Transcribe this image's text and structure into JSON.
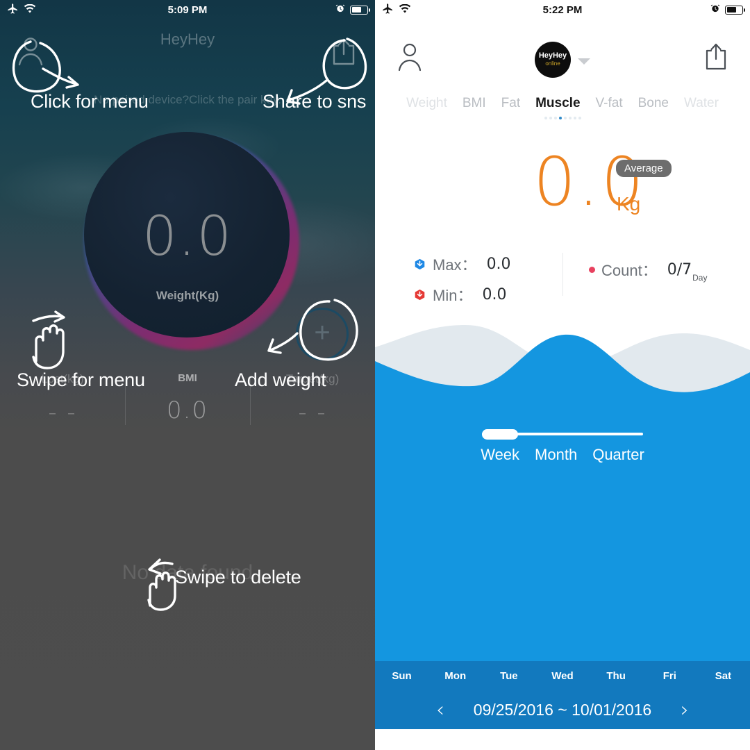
{
  "left": {
    "status": {
      "time": "5:09 PM",
      "airplane_icon": "airplane-icon",
      "wifi_icon": "wifi-icon",
      "alarm_icon": "alarm-icon",
      "battery_icon": "battery-icon"
    },
    "nav": {
      "title": "HeyHey",
      "person_icon": "person-icon",
      "share_icon": "share-icon"
    },
    "hint": "No paired device?Click the pair key.",
    "dial": {
      "value": "0.0",
      "unit": "Weight(Kg)"
    },
    "add_button_icon": "plus-icon",
    "stats": [
      {
        "label": "Lost(kg)",
        "value": "- -"
      },
      {
        "label": "BMI",
        "value": "0.0"
      },
      {
        "label": "Target(kg)",
        "value": "- -"
      }
    ],
    "empty_text": "No data found",
    "annotations": [
      {
        "id": "click-for-menu",
        "text": "Click for menu"
      },
      {
        "id": "share-to-sns",
        "text": "Share to sns"
      },
      {
        "id": "swipe-for-menu",
        "text": "Swipe for menu"
      },
      {
        "id": "add-weight",
        "text": "Add weight"
      },
      {
        "id": "swipe-to-delete",
        "text": "Swipe to delete"
      }
    ]
  },
  "right": {
    "status": {
      "time": "5:22 PM",
      "airplane_icon": "airplane-icon",
      "wifi_icon": "wifi-icon",
      "alarm_icon": "alarm-icon",
      "battery_icon": "battery-icon"
    },
    "nav": {
      "person_icon": "person-icon",
      "share_icon": "share-icon",
      "caret_icon": "chevron-down-icon"
    },
    "avatar": {
      "name": "HeyHey",
      "status": "online"
    },
    "tabs": [
      {
        "label": "Weight",
        "state": "faint"
      },
      {
        "label": "BMI",
        "state": "normal"
      },
      {
        "label": "Fat",
        "state": "normal"
      },
      {
        "label": "Muscle",
        "state": "active"
      },
      {
        "label": "V-fat",
        "state": "normal"
      },
      {
        "label": "Bone",
        "state": "normal"
      },
      {
        "label": "Water",
        "state": "faint"
      }
    ],
    "pager": {
      "count": 8,
      "active_index": 3
    },
    "hero": {
      "value": "0.0",
      "unit": "Kg",
      "badge": "Average",
      "accent": "#ED8422"
    },
    "kpis": {
      "max": {
        "icon": "hexagon-down-icon",
        "label": "Max：",
        "value": "0.0",
        "color": "#1E88E5"
      },
      "min": {
        "icon": "hexagon-down-icon",
        "label": "Min：",
        "value": "0.0",
        "color": "#E53935"
      },
      "count": {
        "icon": "dot-icon",
        "label": "Count：",
        "value": "0/7",
        "suffix": "Day",
        "color": "#E8415F"
      }
    },
    "range_slider": {
      "options": [
        "Week",
        "Month",
        "Quarter"
      ],
      "selected": "Week"
    },
    "weekdays": [
      "Sun",
      "Mon",
      "Tue",
      "Wed",
      "Thu",
      "Fri",
      "Sat"
    ],
    "date_nav": {
      "prev_icon": "chevron-left-icon",
      "next_icon": "chevron-right-icon",
      "range": "09/25/2016 ~ 10/01/2016"
    },
    "colors": {
      "wave_front": "#1496E0",
      "wave_back": "#E2E9EE",
      "footer": "#1279BE"
    }
  }
}
